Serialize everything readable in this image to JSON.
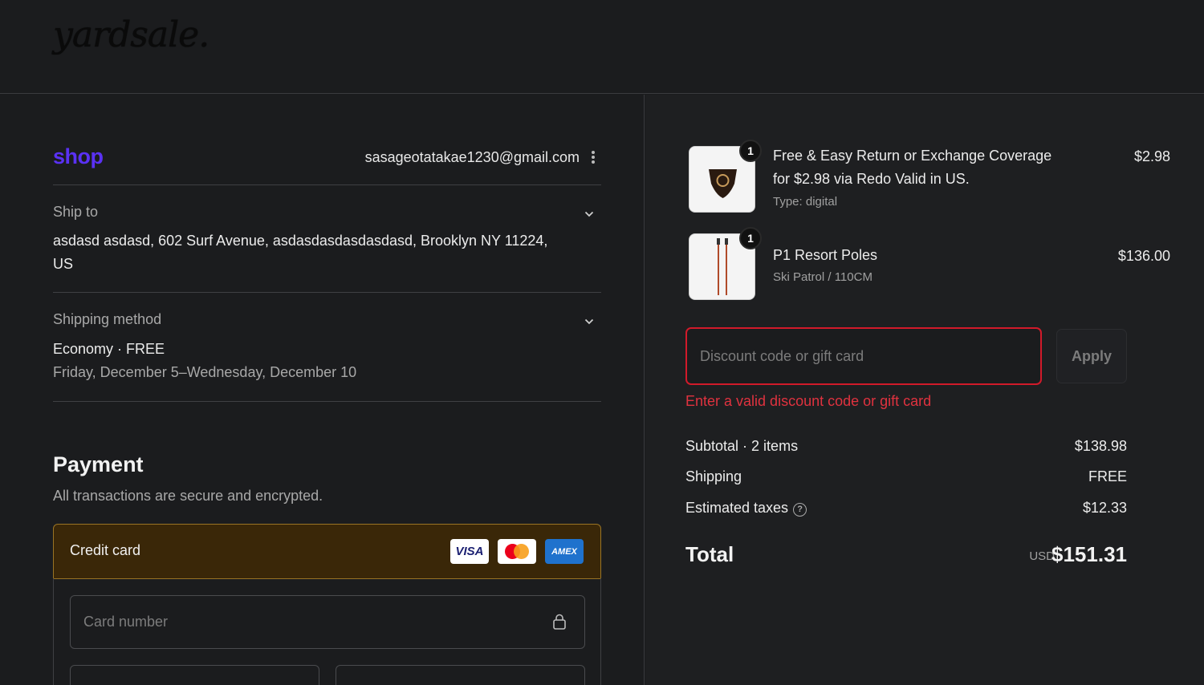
{
  "header": {
    "logo": "yardsale."
  },
  "account": {
    "shop_logo": "shop",
    "email": "sasageotatakae1230@gmail.com"
  },
  "ship_to": {
    "label": "Ship to",
    "address": "asdasd asdasd, 602 Surf Avenue, asdasdasdasdasdasd, Brooklyn NY 11224, US"
  },
  "shipping_method": {
    "label": "Shipping method",
    "name": "Economy · FREE",
    "dates": "Friday, December 5–Wednesday, December 10"
  },
  "payment": {
    "title": "Payment",
    "subtitle": "All transactions are secure and encrypted.",
    "method_label": "Credit card",
    "card_brands": {
      "visa": "VISA",
      "amex": "AMEX"
    },
    "card_number_placeholder": "Card number"
  },
  "cart": {
    "items": [
      {
        "title_line1": "Free & Easy Return or Exchange Coverage",
        "title_line2": "for $2.98 via Redo Valid in US.",
        "variant": "Type: digital",
        "price": "$2.98",
        "quantity": "1",
        "icon": "shield-icon"
      },
      {
        "title_line1": "P1 Resort Poles",
        "variant": "Ski Patrol / 110CM",
        "price": "$136.00",
        "quantity": "1",
        "icon": "ski-poles-image"
      }
    ]
  },
  "discount": {
    "placeholder": "Discount code or gift card",
    "apply_label": "Apply",
    "error": "Enter a valid discount code or gift card"
  },
  "summary": {
    "subtotal_label": "Subtotal · 2 items",
    "subtotal_value": "$138.98",
    "shipping_label": "Shipping",
    "shipping_value": "FREE",
    "taxes_label": "Estimated taxes",
    "taxes_value": "$12.33",
    "total_label": "Total",
    "currency": "USD",
    "total_value": "$151.31"
  },
  "colors": {
    "accent": "#5a31f4",
    "error": "#d11a2a",
    "selected_method": "#3a2708"
  }
}
